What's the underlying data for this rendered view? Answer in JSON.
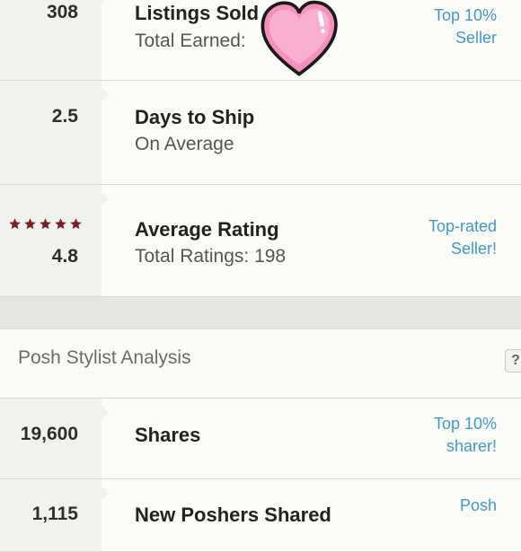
{
  "stats": {
    "listings": {
      "number": "308",
      "title": "Listings Sold",
      "subtitle": "Total Earned:",
      "badge_line1": "Top 10%",
      "badge_line2": "Seller"
    },
    "ship": {
      "number": "2.5",
      "title": "Days to Ship",
      "subtitle": "On Average"
    },
    "rating": {
      "number": "4.8",
      "title": "Average Rating",
      "subtitle": "Total Ratings: 198",
      "badge_line1": "Top-rated",
      "badge_line2": "Seller!",
      "star_count": 5,
      "star_color": "#7a1f24"
    }
  },
  "analysis": {
    "title": "Posh Stylist Analysis",
    "help_label": "?",
    "shares": {
      "number": "19,600",
      "title": "Shares",
      "badge_line1": "Top 10%",
      "badge_line2": "sharer!"
    },
    "new_poshers": {
      "number": "1,115",
      "title": "New Poshers Shared",
      "badge_line1": "Posh"
    }
  },
  "colors": {
    "accent_link": "#3d9bc9",
    "heart_fill": "#f58fbd",
    "heart_outline": "#1a1a1a"
  },
  "overlay_icon": "heart-sticker-icon"
}
